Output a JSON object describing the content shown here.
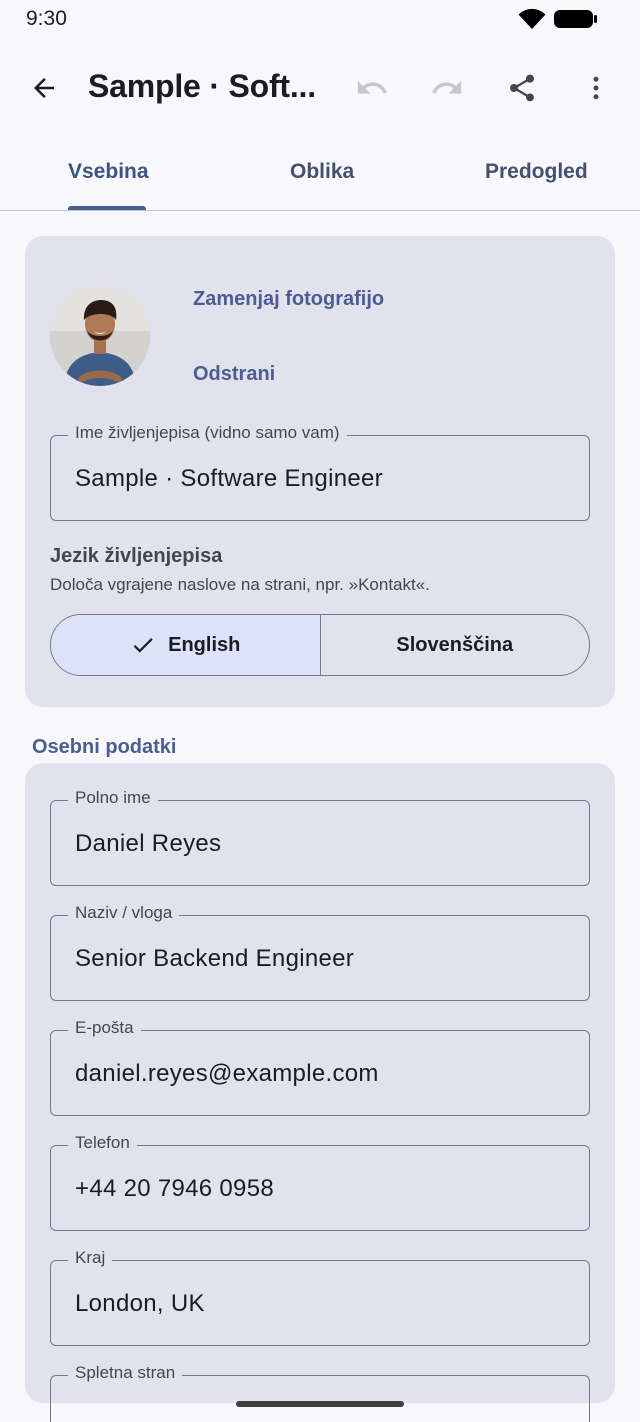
{
  "status_bar": {
    "time": "9:30"
  },
  "app_bar": {
    "title": "Sample · Soft..."
  },
  "tabs": [
    {
      "label": "Vsebina",
      "active": true
    },
    {
      "label": "Oblika",
      "active": false
    },
    {
      "label": "Predogled",
      "active": false
    }
  ],
  "profile": {
    "replace_photo_label": "Zamenjaj fotografijo",
    "remove_photo_label": "Odstrani",
    "resume_name": {
      "label": "Ime življenjepisa (vidno samo vam)",
      "value": "Sample · Software Engineer"
    },
    "language": {
      "title": "Jezik življenjepisa",
      "description": "Določa vgrajene naslove na strani, npr. »Kontakt«.",
      "options": [
        {
          "label": "English",
          "selected": true
        },
        {
          "label": "Slovenščina",
          "selected": false
        }
      ]
    }
  },
  "personal": {
    "section_title": "Osebni podatki",
    "fields": [
      {
        "label": "Polno ime",
        "value": "Daniel Reyes"
      },
      {
        "label": "Naziv / vloga",
        "value": "Senior Backend Engineer"
      },
      {
        "label": "E-pošta",
        "value": "daniel.reyes@example.com"
      },
      {
        "label": "Telefon",
        "value": "+44 20 7946 0958"
      },
      {
        "label": "Kraj",
        "value": "London, UK"
      },
      {
        "label": "Spletna stran",
        "value": ""
      }
    ]
  },
  "colors": {
    "accent": "#4a5e90",
    "card_background": "#e2e2ee",
    "selected_segment": "#dbe2f9",
    "background": "#f8f7fc"
  }
}
